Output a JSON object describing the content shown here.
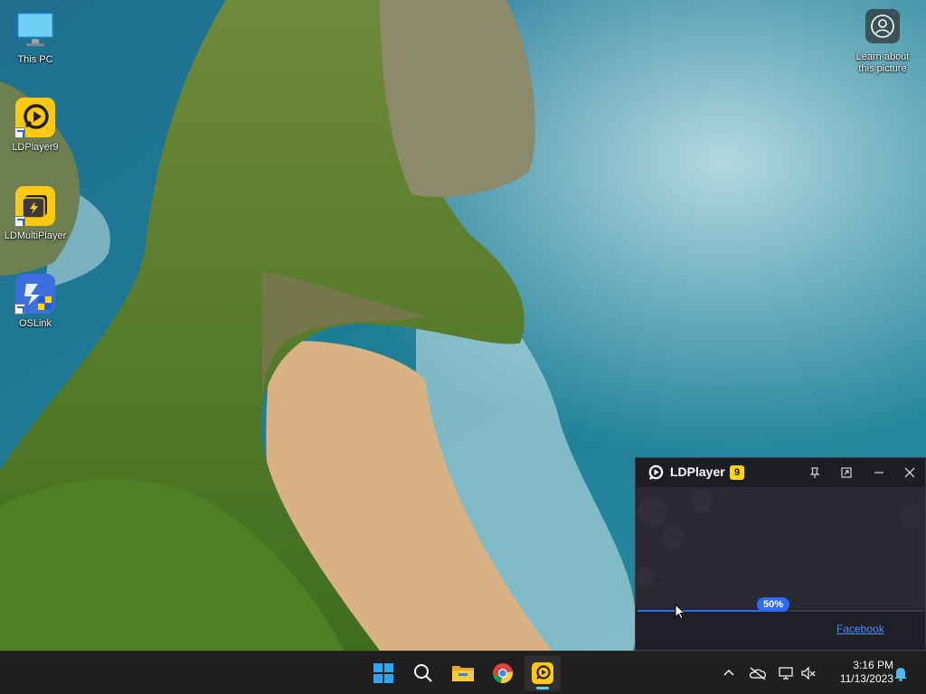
{
  "desktop": {
    "icons": [
      {
        "label": "This PC",
        "icon": "monitor-icon"
      },
      {
        "label": "LDPlayer9",
        "icon": "ldplayer-icon"
      },
      {
        "label": "LDMultiPlayer",
        "icon": "ldmultiplayer-icon"
      },
      {
        "label": "OSLink",
        "icon": "oslink-icon"
      }
    ],
    "learn_about": {
      "label_line1": "Learn about",
      "label_line2": "this picture",
      "icon": "camera-icon"
    }
  },
  "ldplayer": {
    "title": "LDPlayer",
    "version": "9",
    "progress_percent": 50,
    "progress_label": "50%",
    "footer_link": "Facebook",
    "accent": "#2f6bff",
    "version_badge_color": "#ffd400"
  },
  "taskbar": {
    "apps": [
      "start-icon",
      "search-icon",
      "file-explorer-icon",
      "chrome-icon",
      "ldplayer-icon"
    ],
    "tray": [
      "chevron-up-icon",
      "cloud-off-icon",
      "network-icon",
      "volume-muted-icon",
      "notification-icon"
    ],
    "time": "3:16 PM",
    "date": "11/13/2023"
  }
}
